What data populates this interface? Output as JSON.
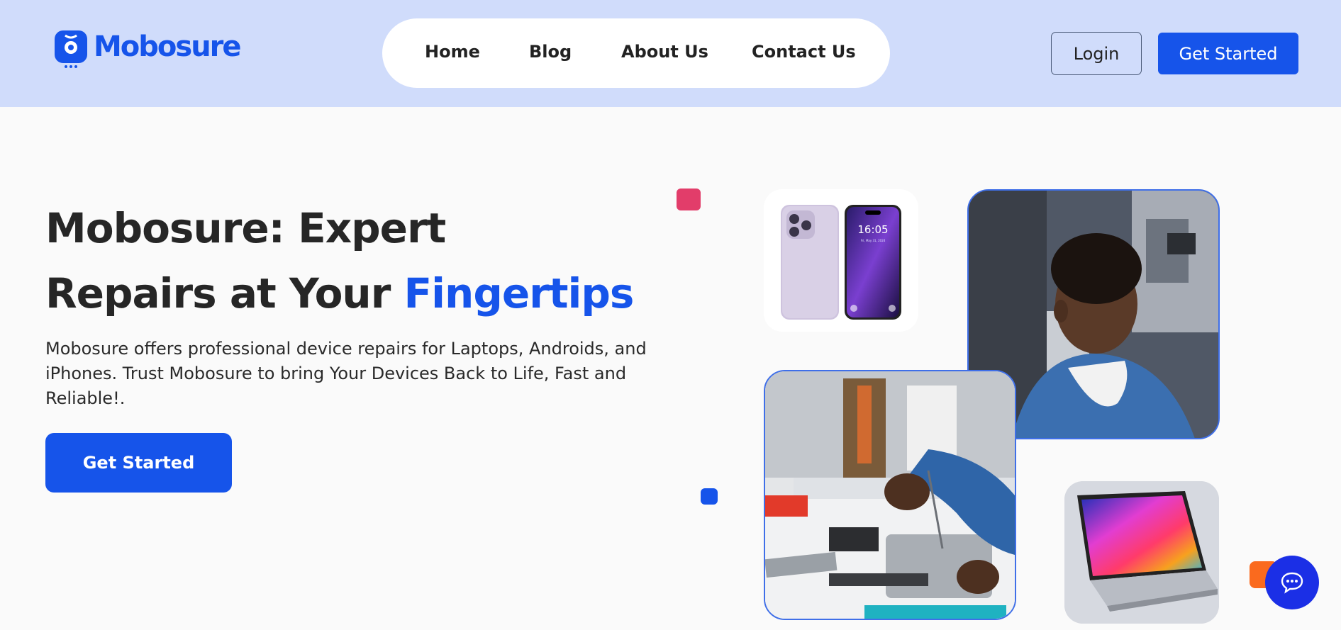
{
  "brand": {
    "name": "Mobosure",
    "color": "#1654ea"
  },
  "nav": {
    "items": [
      {
        "label": "Home"
      },
      {
        "label": "Blog"
      },
      {
        "label": "About Us"
      },
      {
        "label": "Contact Us"
      }
    ]
  },
  "header_actions": {
    "login_label": "Login",
    "get_started_label": "Get Started"
  },
  "hero": {
    "title_line1": "Mobosure: Expert",
    "title_line2_prefix": "Repairs at Your ",
    "title_accent": "Fingertips",
    "description": "Mobosure offers professional device repairs for Laptops, Androids, and iPhones. Trust Mobosure to bring Your Devices Back to Life, Fast and Reliable!.",
    "cta_label": "Get Started"
  },
  "images": {
    "phones_screen_time": "16:05",
    "phones_screen_date": "Fri, May 31, 2024"
  },
  "icons": {
    "logo": "mobosure-logo-icon",
    "chat": "chat-bubble-icon"
  },
  "colors": {
    "header_bg": "#d0dcfb",
    "accent": "#1654ea",
    "deco_pink": "#e23d6a",
    "deco_blue": "#1654ea",
    "deco_orange": "#fa6a1e",
    "chat_button": "#1b2fe6"
  }
}
